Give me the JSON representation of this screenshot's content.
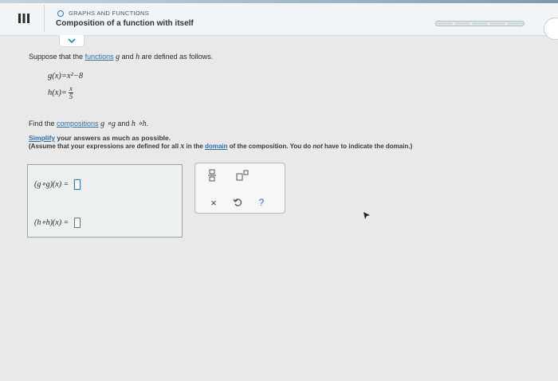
{
  "header": {
    "topic": "GRAPHS AND FUNCTIONS",
    "title": "Composition of a function with itself"
  },
  "problem": {
    "intro_prefix": "Suppose that the ",
    "intro_link": "functions",
    "intro_g": "g",
    "intro_and": " and ",
    "intro_h": "h",
    "intro_suffix": " are defined as follows.",
    "g_lhs": "g(x)",
    "g_rhs": "=x²−8",
    "h_lhs": "h(x)",
    "h_eq": "=",
    "h_num": "x",
    "h_den": "5",
    "find_prefix": "Find the ",
    "find_link": "compositions",
    "find_g": "g",
    "find_op1": "∘g",
    "find_and": " and ",
    "find_h": "h",
    "find_op2": "∘h",
    "find_period": ".",
    "simplify_link": "Simplify",
    "simplify_rest": " your answers as much as possible.",
    "assume_prefix": "(Assume that your expressions are defined for all ",
    "assume_x": "x",
    "assume_mid": " in the ",
    "assume_link": "domain",
    "assume_mid2": " of the composition. You do ",
    "assume_not": "not",
    "assume_end": " have to indicate the domain.)"
  },
  "answers": {
    "row1_label": "(g∘g)(x) =",
    "row2_label": "(h∘h)(x) =",
    "row1_value": "",
    "row2_value": ""
  },
  "toolbox": {
    "fraction_icon": "fraction-icon",
    "exponent_icon": "exponent-icon",
    "clear_label": "×",
    "undo_icon": "undo-icon",
    "help_label": "?"
  },
  "colors": {
    "link": "#2f6fa8",
    "accent": "#2f7bb7"
  }
}
